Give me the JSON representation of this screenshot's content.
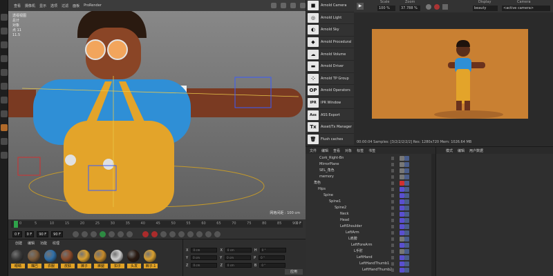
{
  "viewport": {
    "menu": [
      "查看",
      "摄像机",
      "显示",
      "选项",
      "过滤",
      "面板",
      "ProRender"
    ],
    "info_lines": [
      "透视视图",
      "总计",
      "对象",
      "点 11",
      "11.5"
    ],
    "status": "网格间距 : 100 cm"
  },
  "timeline": {
    "ticks": [
      "0",
      "5",
      "10",
      "15",
      "20",
      "25",
      "30",
      "35",
      "40",
      "45",
      "50",
      "55",
      "60",
      "65",
      "70",
      "75",
      "80",
      "85",
      "90"
    ],
    "end_marker": "0 F",
    "current_frame": "0 F",
    "start_field": "0 F",
    "end_field": "90 F",
    "end_field2": "90 F"
  },
  "materials": {
    "menu": [
      "创建",
      "编辑",
      "功能",
      "纹理"
    ],
    "items": [
      {
        "label": "眼睛",
        "color": "#3a3a3a",
        "selected": true
      },
      {
        "label": "嘴巴",
        "color": "#7a5a3a",
        "selected": true
      },
      {
        "label": "衣服",
        "color": "#2f6fa8",
        "selected": true
      },
      {
        "label": "皮肤",
        "color": "#8a4a2a",
        "selected": true
      },
      {
        "label": "裤子",
        "color": "#d9a030",
        "selected": true
      },
      {
        "label": "裤腿",
        "color": "#c58a2a",
        "selected": true
      },
      {
        "label": "扣子",
        "color": "#cfcfcf",
        "selected": true
      },
      {
        "label": "头发",
        "color": "#2a1a12",
        "selected": true
      },
      {
        "label": "裤子.1",
        "color": "#d9a030",
        "selected": true
      }
    ]
  },
  "coords": {
    "rows": [
      {
        "a": "X",
        "av": "0 cm",
        "b": "X",
        "bv": "0 cm",
        "c": "H",
        "cv": "0 °"
      },
      {
        "a": "Y",
        "av": "0 cm",
        "b": "Y",
        "bv": "0 cm",
        "c": "P",
        "cv": "0 °"
      },
      {
        "a": "Z",
        "av": "0 cm",
        "b": "Z",
        "bv": "0 cm",
        "c": "B",
        "cv": "0 °"
      }
    ],
    "apply": "应用"
  },
  "arnold_menu": [
    {
      "label": "Arnold Camera",
      "icon": "camera-icon",
      "glyph": "■"
    },
    {
      "label": "Arnold Light",
      "icon": "light-bulb-icon",
      "glyph": "◎"
    },
    {
      "label": "Arnold Sky",
      "icon": "sky-icon",
      "glyph": "◐"
    },
    {
      "label": "Arnold Procedural",
      "icon": "procedural-icon",
      "glyph": "◆"
    },
    {
      "label": "Arnold Volume",
      "icon": "volume-icon",
      "glyph": "☁"
    },
    {
      "label": "Arnold Driver",
      "icon": "driver-icon",
      "glyph": "▬"
    },
    {
      "label": "Arnold TP Group",
      "icon": "tp-group-icon",
      "glyph": "⁘"
    },
    {
      "label": "Arnold Operators",
      "icon": "operators-icon",
      "glyph": "OP"
    },
    {
      "label": "IPR Window",
      "icon": "ipr-icon",
      "glyph": "IPR"
    },
    {
      "label": "ASS Export",
      "icon": "ass-export-icon",
      "glyph": "Ass"
    },
    {
      "label": "Asset/Tx Manager",
      "icon": "asset-manager-icon",
      "glyph": "Tx"
    },
    {
      "label": "Flush caches",
      "icon": "trash-icon",
      "glyph": "🗑"
    }
  ],
  "render_view": {
    "scale_label": "Scale",
    "scale_value": "100 %",
    "zoom_label": "Zoom",
    "zoom_value": "37.788 %",
    "display_label": "Display",
    "display_value": "beauty",
    "camera_label": "Camera",
    "camera_value": "<active camera>",
    "status": "00:00:04  Samples: [3/2/2/2/2/2]  Res: 1280x720  Mem: 1026.64 MB"
  },
  "object_manager": {
    "menu": [
      "文件",
      "编辑",
      "查看",
      "对象",
      "标签",
      "书签"
    ],
    "rows": [
      {
        "name": "Cork_Right-Bn",
        "indent": 12,
        "tag": "#777777"
      },
      {
        "name": "MirrorPlane",
        "indent": 12,
        "tag": "#777777"
      },
      {
        "name": "SEL_角色",
        "indent": 12,
        "tag": "#777777"
      },
      {
        "name": "memory",
        "indent": 12,
        "tag": "#777777"
      },
      {
        "name": "角色",
        "indent": 4,
        "tag": "#d03030"
      },
      {
        "name": "Hips",
        "indent": 10,
        "tag": "#5a4fd0"
      },
      {
        "name": "Spine",
        "indent": 18,
        "tag": "#5a4fd0"
      },
      {
        "name": "Spine1",
        "indent": 26,
        "tag": "#5a4fd0"
      },
      {
        "name": "Spine2",
        "indent": 34,
        "tag": "#5a4fd0"
      },
      {
        "name": "Neck",
        "indent": 42,
        "tag": "#5a4fd0"
      },
      {
        "name": "Head",
        "indent": 42,
        "tag": "#5a4fd0"
      },
      {
        "name": "LeftShoulder",
        "indent": 42,
        "tag": "#5a4fd0"
      },
      {
        "name": "LeftArm",
        "indent": 50,
        "tag": "#5a4fd0"
      },
      {
        "name": "L肩膀",
        "indent": 54,
        "tag": "#777777"
      },
      {
        "name": "LeftForeArm",
        "indent": 58,
        "tag": "#5a4fd0"
      },
      {
        "name": "L手肘",
        "indent": 62,
        "tag": "#777777"
      },
      {
        "name": "LeftHand",
        "indent": 66,
        "tag": "#5a4fd0"
      },
      {
        "name": "LeftHandThumb1",
        "indent": 70,
        "tag": "#5a4fd0"
      },
      {
        "name": "LeftHandThumb2",
        "indent": 74,
        "tag": "#5a4fd0"
      }
    ]
  },
  "attributes": {
    "menu": [
      "模式",
      "编辑",
      "用户数据"
    ]
  }
}
